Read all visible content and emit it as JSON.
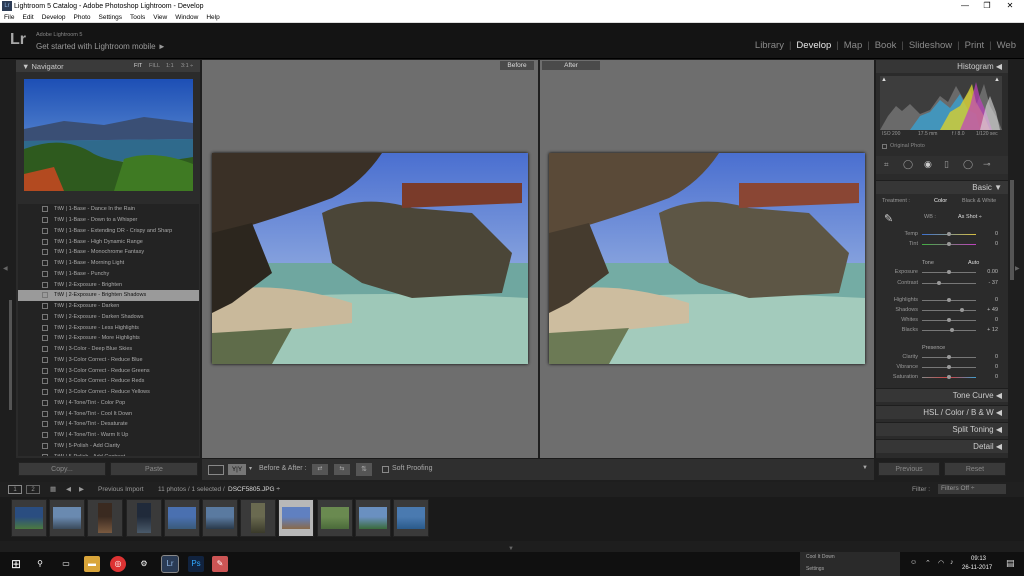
{
  "window": {
    "title": "Lightroom 5 Catalog - Adobe Photoshop Lightroom - Develop",
    "app_icon": "Lr"
  },
  "menu": [
    "File",
    "Edit",
    "Develop",
    "Photo",
    "Settings",
    "Tools",
    "View",
    "Window",
    "Help"
  ],
  "identity": {
    "logo": "Lr",
    "version": "Adobe Lightroom 5",
    "mobile": "Get started with Lightroom mobile ►"
  },
  "modules": [
    "Library",
    "Develop",
    "Map",
    "Book",
    "Slideshow",
    "Print",
    "Web"
  ],
  "active_module": "Develop",
  "navigator": {
    "title": "Navigator",
    "zoom": [
      "FIT",
      "FILL",
      "1:1",
      "3:1 ÷"
    ]
  },
  "presets": [
    "TtW | 1-Base - Dance In the Rain",
    "TtW | 1-Base - Down to a Whisper",
    "TtW | 1-Base - Extending DR - Crispy and Sharp",
    "TtW | 1-Base - High Dynamic Range",
    "TtW | 1-Base - Monochrome Fantasy",
    "TtW | 1-Base - Morning Light",
    "TtW | 1-Base - Punchy",
    "TtW | 2-Exposure - Brighten",
    "TtW | 2-Exposure - Brighten Shadows",
    "TtW | 2-Exposure - Darken",
    "TtW | 2-Exposure - Darken Shadows",
    "TtW | 2-Exposure - Less Highlights",
    "TtW | 2-Exposure - More Highlights",
    "TtW | 3-Color - Deep Blue Skies",
    "TtW | 3-Color Correct - Reduce Blue",
    "TtW | 3-Color Correct - Reduce Greens",
    "TtW | 3-Color Correct - Reduce Reds",
    "TtW | 3-Color Correct - Reduce Yellows",
    "TtW | 4-Tone/Tint - Color Pop",
    "TtW | 4-Tone/Tint - Cool It Down",
    "TtW | 4-Tone/Tint - Desaturate",
    "TtW | 4-Tone/Tint - Warm It Up",
    "TtW | 5-Polish - Add Clarity",
    "TtW | 5-Polish - Add Contrast"
  ],
  "selected_preset_index": 8,
  "left_buttons": {
    "copy": "Copy...",
    "paste": "Paste"
  },
  "compare": {
    "before": "Before",
    "after": "After"
  },
  "toolbar": {
    "yy": "Y|Y",
    "before_after": "Before & After :",
    "soft_proofing": "Soft Proofing"
  },
  "histogram": {
    "title": "Histogram",
    "iso": "ISO 200",
    "focal": "17.5 mm",
    "aperture": "f / 8.0",
    "shutter": "1/120 sec",
    "original_photo": "Original Photo"
  },
  "basic": {
    "title": "Basic",
    "treatment_label": "Treatment :",
    "color": "Color",
    "bw": "Black & White",
    "wb_label": "WB :",
    "wb_value": "As Shot ÷",
    "tone_label": "Tone",
    "auto": "Auto",
    "presence_label": "Presence",
    "sliders": [
      {
        "name": "Temp",
        "value": "0",
        "pos": 0.5
      },
      {
        "name": "Tint",
        "value": "0",
        "pos": 0.5
      },
      {
        "name": "Exposure",
        "value": "0.00",
        "pos": 0.5
      },
      {
        "name": "Contrast",
        "value": "- 37",
        "pos": 0.32
      },
      {
        "name": "Highlights",
        "value": "0",
        "pos": 0.5
      },
      {
        "name": "Shadows",
        "value": "+ 49",
        "pos": 0.74
      },
      {
        "name": "Whites",
        "value": "0",
        "pos": 0.5
      },
      {
        "name": "Blacks",
        "value": "+ 12",
        "pos": 0.56
      },
      {
        "name": "Clarity",
        "value": "0",
        "pos": 0.5
      },
      {
        "name": "Vibrance",
        "value": "0",
        "pos": 0.5
      },
      {
        "name": "Saturation",
        "value": "0",
        "pos": 0.5
      }
    ]
  },
  "right_sections": {
    "tone_curve": "Tone Curve",
    "hsl": "HSL  /  Color  /  B & W",
    "split_toning": "Split Toning",
    "detail": "Detail"
  },
  "right_buttons": {
    "previous": "Previous",
    "reset": "Reset"
  },
  "filmstrip": {
    "source": "Previous Import",
    "count": "11 photos / 1 selected /",
    "filename": "DSCF5805.JPG ÷",
    "filter_label": "Filter :",
    "filter_value": "Filters Off",
    "thumbs": 11,
    "selected_thumb": 7
  },
  "taskbar": {
    "time": "09:13",
    "date": "26-11-2017",
    "popup1": "Cool It Down",
    "popup2": "Settings"
  },
  "colors": {
    "accent": "#e8e8e8",
    "panel": "#2b2b2b",
    "sky": "#5b7fd4",
    "water": "#8cc3b5"
  }
}
